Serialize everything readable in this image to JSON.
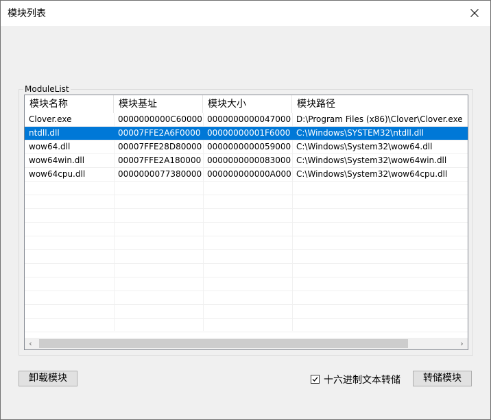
{
  "window": {
    "title": "模块列表"
  },
  "group": {
    "label": "ModuleList"
  },
  "table": {
    "columns": [
      "模块名称",
      "模块基址",
      "模块大小",
      "模块路径"
    ],
    "rows": [
      [
        "Clover.exe",
        "0000000000C60000",
        "0000000000047000",
        "D:\\Program Files (x86)\\Clover\\Clover.exe"
      ],
      [
        "ntdll.dll",
        "00007FFE2A6F0000",
        "00000000001F6000",
        "C:\\Windows\\SYSTEM32\\ntdll.dll"
      ],
      [
        "wow64.dll",
        "00007FFE28D80000",
        "0000000000059000",
        "C:\\Windows\\System32\\wow64.dll"
      ],
      [
        "wow64win.dll",
        "00007FFE2A180000",
        "0000000000083000",
        "C:\\Windows\\System32\\wow64win.dll"
      ],
      [
        "wow64cpu.dll",
        "0000000077380000",
        "000000000000A000",
        "C:\\Windows\\System32\\wow64cpu.dll"
      ]
    ],
    "selected_row": 1
  },
  "buttons": {
    "unload": "卸载模块",
    "dump": "转储模块"
  },
  "checkbox": {
    "label": "十六进制文本转储",
    "checked": true
  },
  "colors": {
    "selection": "#0078d7",
    "window_bg": "#f0f0f0"
  }
}
